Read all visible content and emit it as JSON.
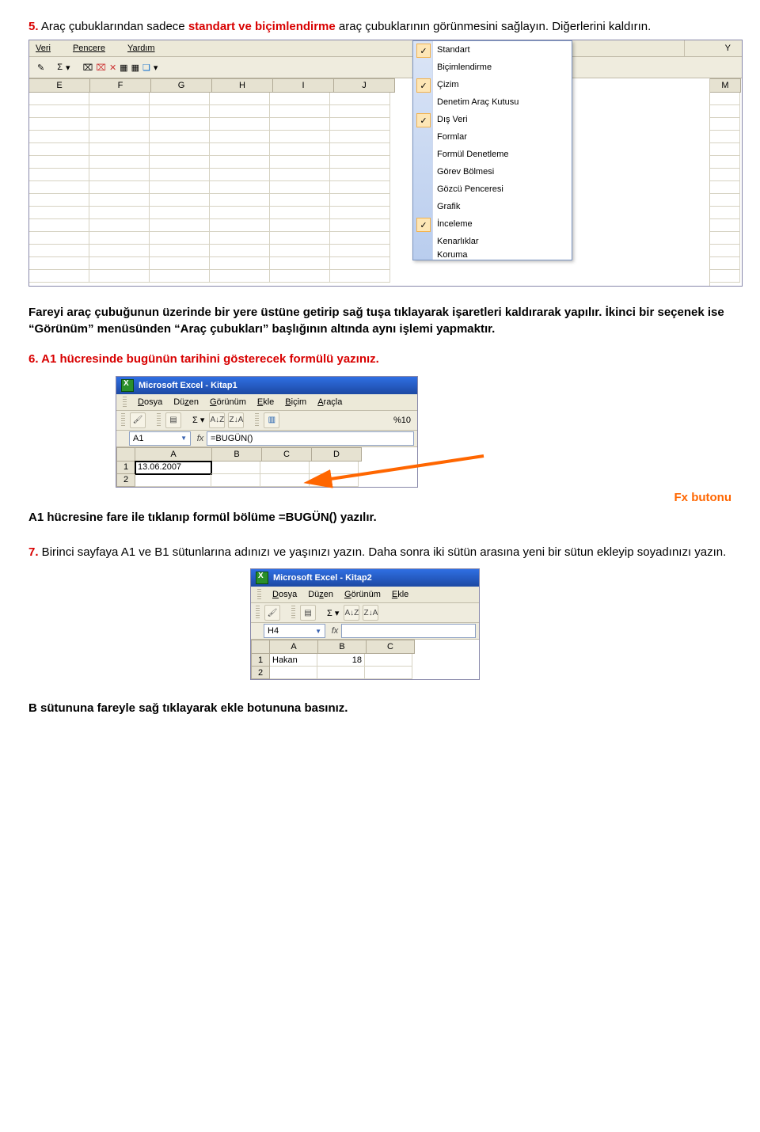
{
  "q5": {
    "num": "5.",
    "pre": " Araç çubuklarından sadece ",
    "kw": "standart ve biçimlendirme",
    "post": " araç çubuklarının görünmesini sağlayın. Diğerlerini kaldırın."
  },
  "shot1": {
    "menus": [
      "Veri",
      "Pencere",
      "Yardım"
    ],
    "cols": [
      "E",
      "F",
      "G",
      "H",
      "I",
      "J"
    ],
    "rightcols": [
      "M"
    ],
    "Ycol": "Y",
    "ctx": [
      {
        "label": "Standart",
        "checked": true
      },
      {
        "label": "Biçimlendirme",
        "checked": false
      },
      {
        "label": "Çizim",
        "checked": true
      },
      {
        "label": "Denetim Araç Kutusu",
        "checked": false
      },
      {
        "label": "Dış Veri",
        "checked": true
      },
      {
        "label": "Formlar",
        "checked": false
      },
      {
        "label": "Formül Denetleme",
        "checked": false
      },
      {
        "label": "Görev Bölmesi",
        "checked": false
      },
      {
        "label": "Gözcü Penceresi",
        "checked": false
      },
      {
        "label": "Grafik",
        "checked": false
      },
      {
        "label": "İnceleme",
        "checked": true
      },
      {
        "label": "Kenarlıklar",
        "checked": false
      },
      {
        "label": "Koruma",
        "checked": false
      }
    ]
  },
  "exp5": "Fareyi araç çubuğunun üzerinde bir yere üstüne getirip sağ tuşa tıklayarak işaretleri kaldırarak yapılır. İkinci bir seçenek ise “Görünüm” menüsünden “Araç çubukları” başlığının altında aynı işlemi yapmaktır.",
  "q6": "6. A1 hücresinde bugünün tarihini gösterecek formülü yazınız.",
  "shot2": {
    "title": "Microsoft Excel - Kitap1",
    "menus": [
      "Dosya",
      "Düzen",
      "Görünüm",
      "Ekle",
      "Biçim",
      "Araçla"
    ],
    "tb2_right": "%10",
    "namebox": "A1",
    "fx": "fx",
    "formula": "=BUGÜN()",
    "cols": [
      "A",
      "B",
      "C",
      "D"
    ],
    "rows": [
      "1",
      "2"
    ],
    "a1": "13.06.2007"
  },
  "ans6": "A1 hücresine fare ile tıklanıp formül bölüme =BUGÜN()  yazılır.",
  "fxlabel": "Fx butonu",
  "q7": {
    "num": "7.",
    "text": " Birinci sayfaya A1 ve B1 sütunlarına adınızı ve yaşınızı yazın. Daha sonra iki sütün arasına yeni bir sütun ekleyip soyadınızı yazın."
  },
  "shot3": {
    "title": "Microsoft Excel - Kitap2",
    "menus": [
      "Dosya",
      "Düzen",
      "Görünüm",
      "Ekle"
    ],
    "namebox": "H4",
    "fx": "fx",
    "formula": "",
    "cols": [
      "A",
      "B",
      "C"
    ],
    "rows": [
      "1",
      "2"
    ],
    "a1": "Hakan",
    "b1": "18"
  },
  "lastline": "B sütununa fareyle sağ tıklayarak ekle botununa basınız."
}
